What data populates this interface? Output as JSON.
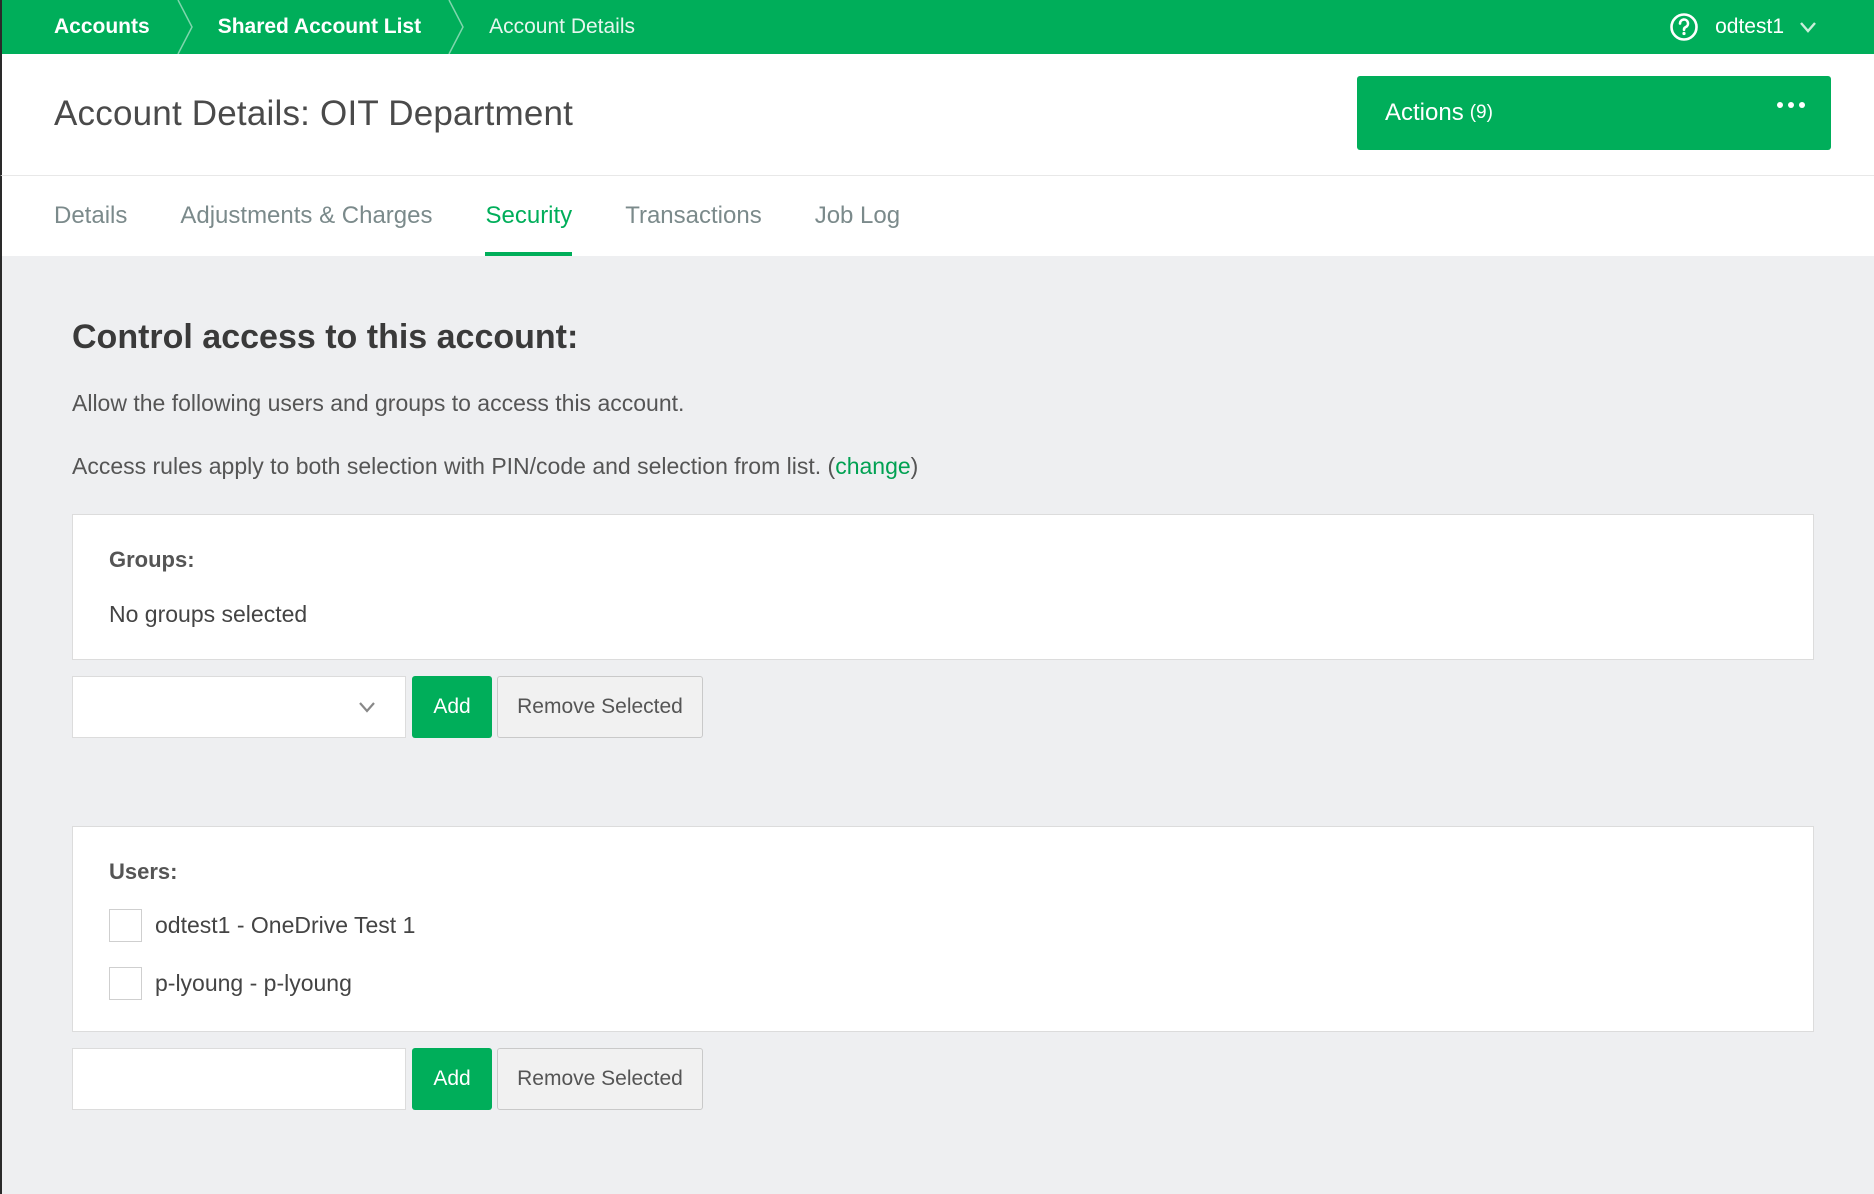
{
  "breadcrumb": {
    "items": [
      {
        "label": "Accounts"
      },
      {
        "label": "Shared Account List"
      },
      {
        "label": "Account Details"
      }
    ]
  },
  "user_menu": {
    "username": "odtest1",
    "help_icon": "help-circle-icon",
    "chevron_icon": "chevron-down-icon"
  },
  "header": {
    "title": "Account Details: OIT Department",
    "actions": {
      "label": "Actions",
      "count": "(9)",
      "icon": "more-dots-icon"
    }
  },
  "tabs": [
    {
      "label": "Details",
      "active": false
    },
    {
      "label": "Adjustments & Charges",
      "active": false
    },
    {
      "label": "Security",
      "active": true
    },
    {
      "label": "Transactions",
      "active": false
    },
    {
      "label": "Job Log",
      "active": false
    }
  ],
  "security": {
    "title": "Control access to this account:",
    "description": "Allow the following users and groups to access this account.",
    "rules_prefix": "Access rules apply to both selection with PIN/code and selection from list. (",
    "rules_link": "change",
    "rules_suffix": ")"
  },
  "groups": {
    "label": "Groups:",
    "empty_text": "No groups selected",
    "select_value": "",
    "add_label": "Add",
    "remove_label": "Remove Selected"
  },
  "users": {
    "label": "Users:",
    "items": [
      {
        "label": "odtest1 - OneDrive Test 1",
        "checked": false
      },
      {
        "label": "p-lyoung - p-lyoung",
        "checked": false
      }
    ],
    "input_value": "",
    "input_placeholder": "",
    "add_label": "Add",
    "remove_label": "Remove Selected"
  },
  "colors": {
    "brand": "#00ae5a",
    "link": "#00a152",
    "background": "#eeeff1"
  }
}
